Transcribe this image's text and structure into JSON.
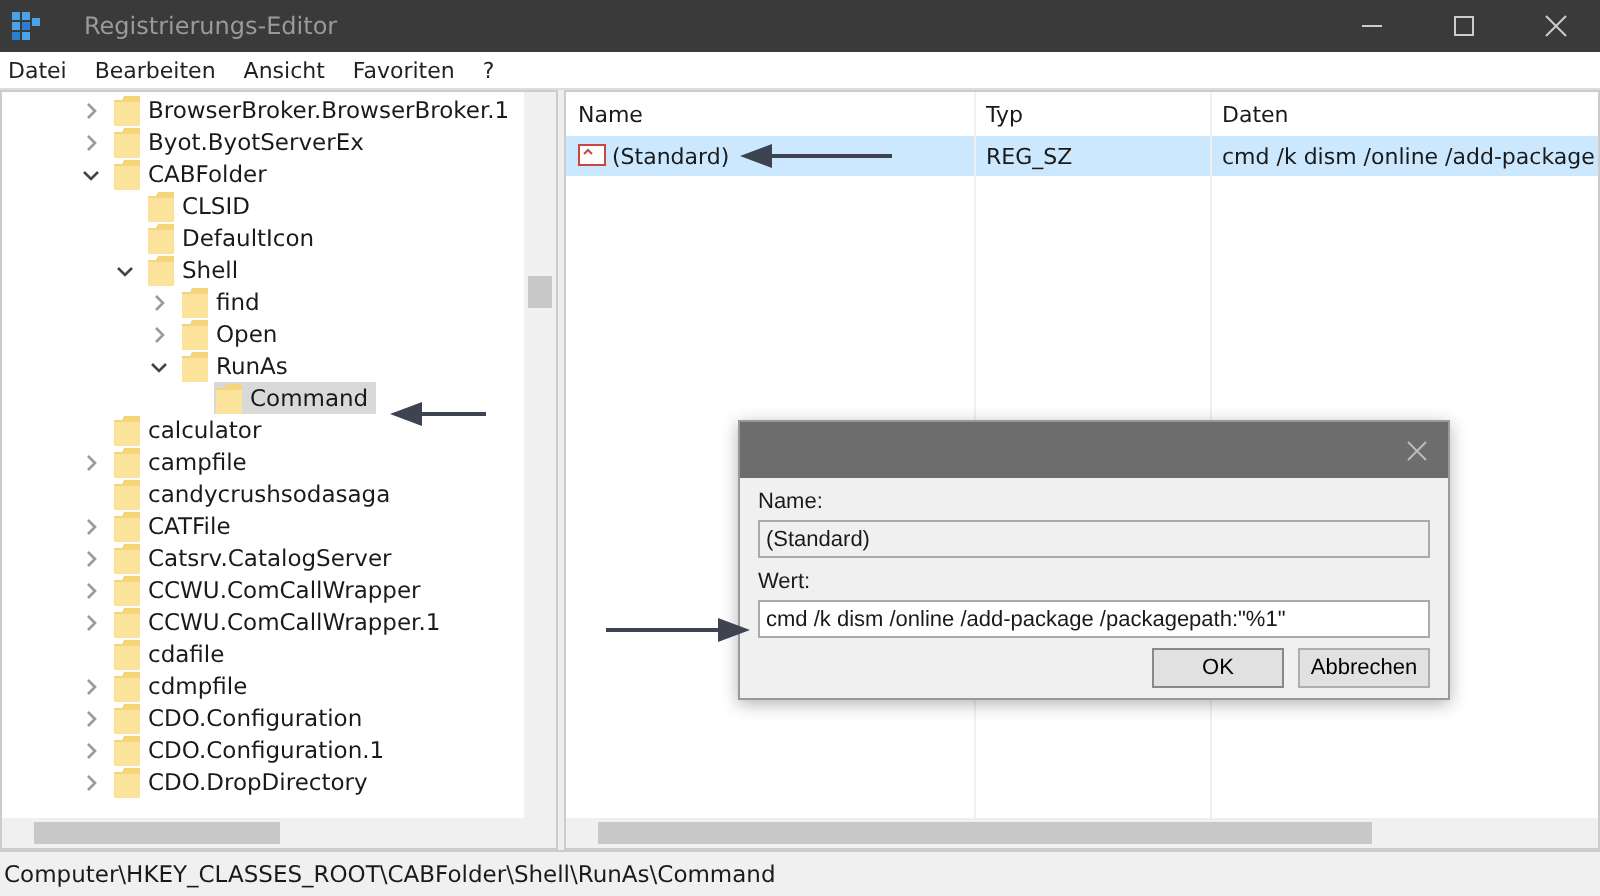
{
  "window": {
    "title": "Registrierungs-Editor"
  },
  "menu": [
    "Datei",
    "Bearbeiten",
    "Ansicht",
    "Favoriten",
    "?"
  ],
  "tree": [
    {
      "label": "BrowserBroker.BrowserBroker.1",
      "expanded": false,
      "selected": false
    },
    {
      "label": "Byot.ByotServerEx",
      "expanded": false,
      "selected": false
    },
    {
      "label": "CABFolder",
      "expanded": true,
      "selected": false,
      "children": [
        {
          "label": "CLSID",
          "selected": false
        },
        {
          "label": "DefaultIcon",
          "selected": false
        },
        {
          "label": "Shell",
          "expanded": true,
          "selected": false,
          "children": [
            {
              "label": "find",
              "expanded": false,
              "selected": false
            },
            {
              "label": "Open",
              "expanded": false,
              "selected": false
            },
            {
              "label": "RunAs",
              "expanded": true,
              "selected": false,
              "children": [
                {
                  "label": "Command",
                  "selected": true
                }
              ]
            }
          ]
        }
      ]
    },
    {
      "label": "calculator",
      "selected": false
    },
    {
      "label": "campfile",
      "expanded": false,
      "selected": false
    },
    {
      "label": "candycrushsodasaga",
      "selected": false
    },
    {
      "label": "CATFile",
      "expanded": false,
      "selected": false
    },
    {
      "label": "Catsrv.CatalogServer",
      "expanded": false,
      "selected": false
    },
    {
      "label": "CCWU.ComCallWrapper",
      "expanded": false,
      "selected": false
    },
    {
      "label": "CCWU.ComCallWrapper.1",
      "expanded": false,
      "selected": false
    },
    {
      "label": "cdafile",
      "selected": false
    },
    {
      "label": "cdmpfile",
      "expanded": false,
      "selected": false
    },
    {
      "label": "CDO.Configuration",
      "expanded": false,
      "selected": false
    },
    {
      "label": "CDO.Configuration.1",
      "expanded": false,
      "selected": false
    },
    {
      "label": "CDO.DropDirectory",
      "expanded": false,
      "selected": false
    }
  ],
  "values": {
    "columns": [
      "Name",
      "Typ",
      "Daten"
    ],
    "rows": [
      {
        "name": "(Standard)",
        "type": "REG_SZ",
        "data": "cmd /k dism /online /add-package",
        "selected": true
      }
    ]
  },
  "dialog": {
    "name_label": "Name:",
    "name_value": "(Standard)",
    "value_label": "Wert:",
    "value": "cmd /k dism /online /add-package /packagepath:\"%1\"",
    "buttons": [
      "OK",
      "Abbrechen"
    ]
  },
  "status_bar": "Computer\\HKEY_CLASSES_ROOT\\CABFolder\\Shell\\RunAs\\Command"
}
